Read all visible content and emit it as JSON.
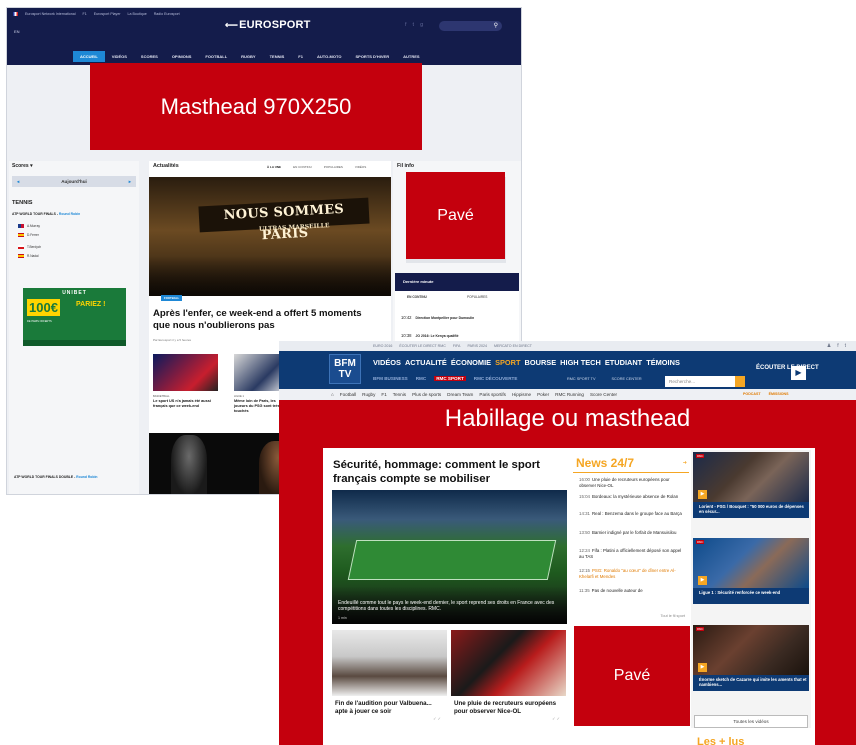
{
  "eurosport": {
    "top_links": [
      "Eurosport Network International",
      "F1",
      "Eurosport Player",
      "La Boutique",
      "Radio Eurosport"
    ],
    "edition": "EN",
    "logo": "EUROSPORT",
    "logo_arrow": "⟵",
    "social_icons": [
      "f",
      "t",
      "g"
    ],
    "nav": [
      "ACCUEIL",
      "VIDÉOS",
      "SCORES",
      "OPINIONS",
      "FOOTBALL",
      "RUGBY",
      "TENNIS",
      "F1",
      "AUTO-MOTO",
      "SPORTS D'HIVER",
      "AUTRES"
    ],
    "scores_title": "Scores ▾",
    "day_label": "Aujourd'hui",
    "day_prev": "◂",
    "day_next": "▸",
    "sport_title": "TENNIS",
    "tour_label": "ATP WORLD TOUR FINALS -",
    "tour_link": "Round Robin",
    "players": [
      "A.Murray",
      "D.Ferrer",
      "T.Berdych",
      "R.Nadal"
    ],
    "ad": {
      "brand": "UNIBET",
      "amount": "100€",
      "cta": "PARIEZ !",
      "sub": "DE PARIS OFFERTS"
    },
    "doubles_label": "ATP WORLD TOUR FINALS DOUBLE -",
    "doubles_link": "Round Robin",
    "actu_title": "Actualités",
    "actu_tabs": [
      "À LA UNE",
      "EN CONTINU",
      "POPULAIRES",
      "VIDÉOS"
    ],
    "hero_banner": "NOUS SOMMES PARIS",
    "hero_banner2": "ULTRAS MARSEILLE",
    "hero_tag": "FOOTBALL",
    "headline": "Après l'enfer, ce week-end a offert 5 moments que nous n'oublierons pas",
    "byline": "Par Eurosport il y a 5 heures",
    "small_stories": [
      {
        "category": "BASKETBALL",
        "title": "Le sport US n'a jamais été aussi français que ce week-end"
      },
      {
        "category": "LIGUE 1",
        "title": "Même loin de Paris, les joueurs du PSG sont très touchés"
      }
    ],
    "fil_info": "Fil info",
    "derniere_minute": {
      "title": "Dernière minute",
      "tabs": [
        "EN CONTINU",
        "POPULAIRES"
      ],
      "items": [
        {
          "time": "10:42",
          "text": "Direction Montpellier pour Dumoulin"
        },
        {
          "time": "10:38",
          "text": "JO 2016: Le Kenya qualifié"
        }
      ]
    }
  },
  "overlays": {
    "masthead": "Masthead 970X250",
    "pave_top": "Pavé",
    "habillage": "Habillage ou masthead",
    "pave_bottom": "Pavé"
  },
  "bfmtv": {
    "top_links": [
      "EURO 2016",
      "ÉCOUTER LE DIRECT RMC",
      "FIFA",
      "PARIS 2024",
      "MERCATO EN DIRECT"
    ],
    "top_social": [
      "♟",
      "f",
      "t"
    ],
    "logo": "BFM TV",
    "nav": [
      "VIDÉOS",
      "ACTUALITÉ",
      "ÉCONOMIE",
      "SPORT",
      "BOURSE",
      "HIGH TECH",
      "ETUDIANT",
      "TÉMOINS"
    ],
    "sub_brands": [
      "BFM BUSINESS",
      "RMC",
      "RMC SPORT",
      "RMC DÉCOUVERTE"
    ],
    "controls": [
      "RMC SPORT TV",
      "SCORE CENTER"
    ],
    "search_placeholder": "Recherche...",
    "listen_live": "ÉCOUTER LE DIRECT",
    "subnav": [
      "Football",
      "Rugby",
      "F1",
      "Tennis",
      "Plus de sports",
      "Dream Team",
      "Paris sportifs",
      "Hippisme",
      "Poker",
      "RMC Running",
      "Score Center"
    ],
    "subnav_right": [
      "PODCAST",
      "ÉMISSIONS"
    ],
    "lead_title": "Sécurité, hommage: comment le sport français compte se mobiliser",
    "lead_caption": "Endeuillé comme tout le pays le week-end dernier, le sport reprend ses droits en France avec des compétitions dans toutes les disciplines. RMC.",
    "lead_time": "1 min",
    "news_title": "News 24/7",
    "news": [
      {
        "time": "16:00",
        "text": "Une pluie de recruteurs européens pour observer Nice-OL",
        "highlight": false
      },
      {
        "time": "15:04",
        "text": "Bordeaux: la mystérieuse absence de Rolan",
        "highlight": false
      },
      {
        "time": "14:31",
        "text": "Real : Benzema dans le groupe face au Barça",
        "highlight": false
      },
      {
        "time": "13:50",
        "text": "Barnier indigné par le forfait de Mansuisilou",
        "highlight": false
      },
      {
        "time": "12:24",
        "text": "Fifa : Platini a officiellement déposé son appel au TAS",
        "highlight": false
      },
      {
        "time": "12:15",
        "text": "PSG: Ronaldo \"au cœur\" de dîner entre Al-Khelaïfi et Mendes",
        "highlight": true
      },
      {
        "time": "11:35",
        "text": "Pas de nouvelle auteur de",
        "highlight": false
      }
    ],
    "news_all": "Tout le fil sport",
    "videos": [
      {
        "badge": "RMC",
        "title": "Lorient - PSG / Bouquet : \"50 000 euros de dépenses en sécur..."
      },
      {
        "badge": "RMC",
        "title": "Ligue 1 : Sécurité renforcée ce week-end"
      },
      {
        "badge": "RMC",
        "title": "Énorme sketch de Cazarre qui imite les aments that et nambiens..."
      }
    ],
    "all_videos": "Toutes les vidéos",
    "cards": [
      {
        "title": "Fin de l'audition pour Valbuena... apte à jouer ce soir"
      },
      {
        "title": "Une pluie de recruteurs européens pour observer Nice-OL"
      }
    ],
    "les_plus": "Les + lus"
  }
}
